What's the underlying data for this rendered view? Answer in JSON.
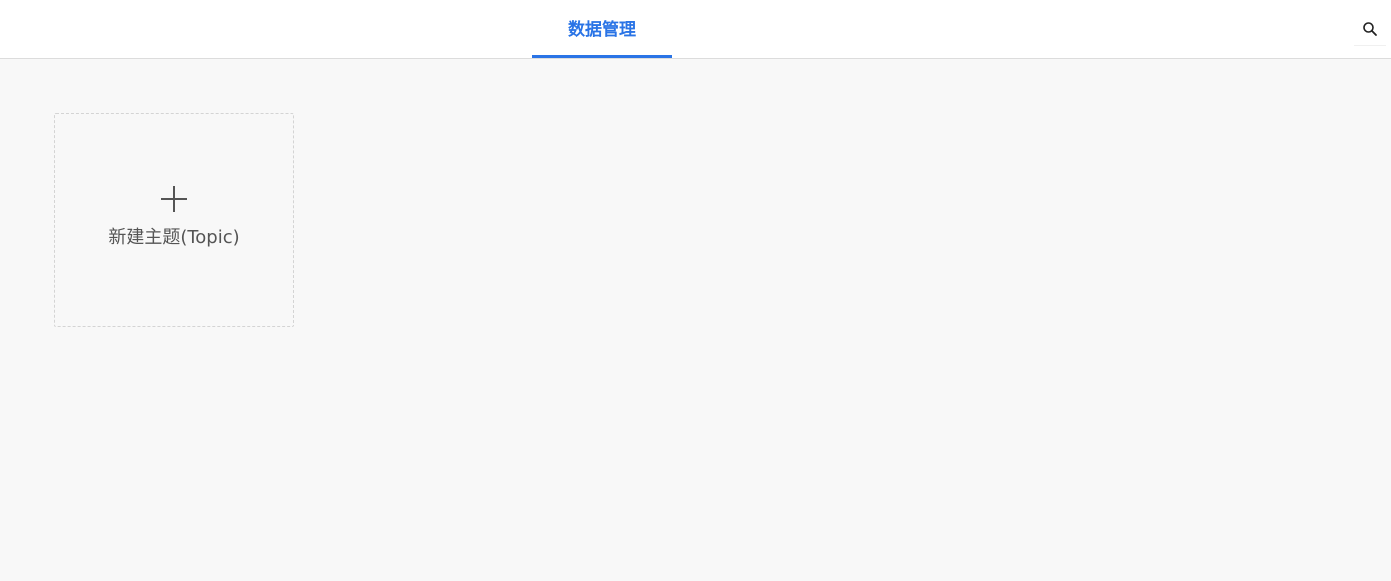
{
  "header": {
    "tabs": [
      {
        "label": "数据管理",
        "active": true
      }
    ],
    "search_icon": "search-icon"
  },
  "main": {
    "new_topic_card": {
      "icon": "plus-icon",
      "label": "新建主题(Topic)"
    }
  },
  "colors": {
    "accent": "#2a74e6",
    "background": "#f8f8f8",
    "header_background": "#ffffff",
    "text_muted": "#555555",
    "card_border": "#d4d4d4"
  }
}
